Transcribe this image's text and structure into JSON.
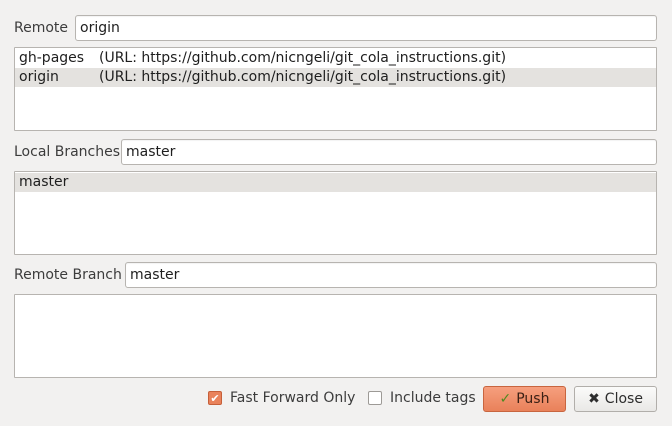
{
  "remote": {
    "label": "Remote",
    "value": "origin"
  },
  "remotes_list": [
    {
      "name": "gh-pages",
      "url": "(URL: https://github.com/nicngeli/git_cola_instructions.git)",
      "selected": false
    },
    {
      "name": "origin",
      "url": "(URL: https://github.com/nicngeli/git_cola_instructions.git)",
      "selected": true
    }
  ],
  "local_branches": {
    "label": "Local Branches",
    "value": "master"
  },
  "local_branches_list": [
    {
      "name": "master",
      "selected": true
    }
  ],
  "remote_branch": {
    "label": "Remote Branch",
    "value": "master"
  },
  "options": {
    "fast_forward_only": {
      "label": "Fast Forward Only",
      "checked": true
    },
    "include_tags": {
      "label": "Include tags",
      "checked": false
    }
  },
  "buttons": {
    "push": {
      "label": "Push",
      "icon": "check-icon"
    },
    "close": {
      "label": "Close",
      "icon": "x-icon"
    }
  },
  "colors": {
    "accent": "#e9825b",
    "selection": "#e4e2df",
    "window_bg": "#f2f1f0"
  }
}
